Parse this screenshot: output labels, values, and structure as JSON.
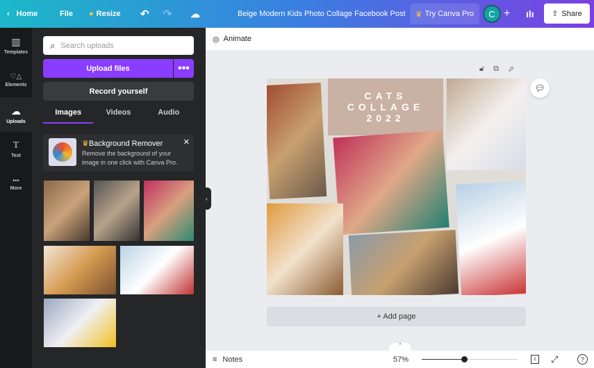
{
  "topbar": {
    "home": "Home",
    "file": "File",
    "resize": "Resize",
    "title": "Beige Modern Kids Photo Collage Facebook Post",
    "try_pro": "Try Canva Pro",
    "avatar": "C",
    "share": "Share"
  },
  "rail": [
    {
      "label": "Templates",
      "icon": "▥"
    },
    {
      "label": "Elements",
      "icon": "♡△"
    },
    {
      "label": "Uploads",
      "icon": "☁"
    },
    {
      "label": "Text",
      "icon": "T"
    },
    {
      "label": "More",
      "icon": "•••"
    }
  ],
  "panel": {
    "search_placeholder": "Search uploads",
    "upload": "Upload files",
    "more": "•••",
    "record": "Record yourself",
    "tabs": [
      "Images",
      "Videos",
      "Audio"
    ],
    "promo": {
      "title": "Background Remover",
      "text": "Remove the background of your image in one click with Canva Pro."
    }
  },
  "editor": {
    "animate": "Animate",
    "collage_title": "CATS COLLAGE 2022",
    "add_page": "+ Add page"
  },
  "footer": {
    "notes": "Notes",
    "zoom": "57%",
    "zoom_percent": 44,
    "page": "1"
  }
}
